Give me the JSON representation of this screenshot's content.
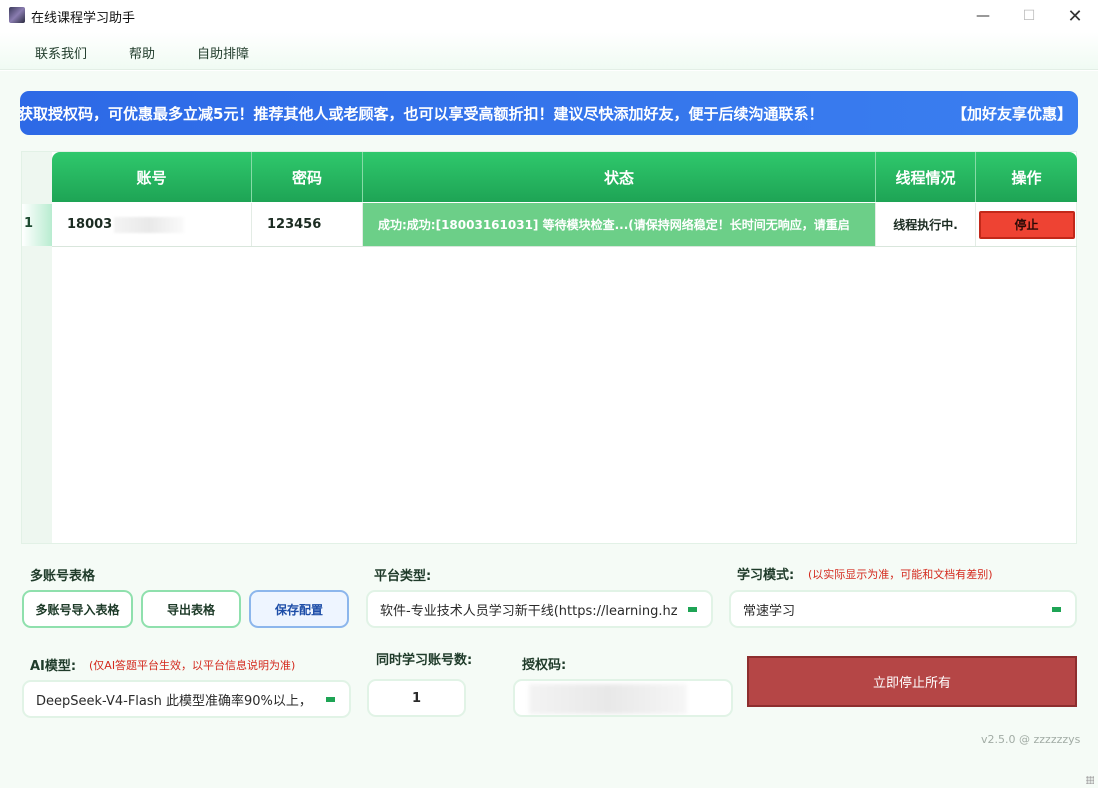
{
  "window": {
    "title": "在线课程学习助手",
    "minimize_glyph": "—",
    "maximize_glyph": "☐",
    "close_glyph": "✕"
  },
  "menu": [
    "联系我们",
    "帮助",
    "自助排障"
  ],
  "banner": {
    "text": "获取授权码，可优惠最多立减5元！推荐其他人或老顾客，也可以享受高额折扣！建议尽快添加好友，便于后续沟通联系！",
    "link": "【加好友享优惠】"
  },
  "table": {
    "headers": [
      "账号",
      "密码",
      "状态",
      "线程情况",
      "操作"
    ],
    "rows": [
      {
        "index": "1",
        "account": "18003",
        "password": "123456",
        "status": "成功:成功:[18003161031] 等待模块检查...(请保持网络稳定！长时间无响应，请重启",
        "thread": "线程执行中.",
        "action": "停止"
      }
    ]
  },
  "multi_account": {
    "label": "多账号表格",
    "import": "多账号导入表格",
    "export": "导出表格",
    "save": "保存配置"
  },
  "platform": {
    "label": "平台类型:",
    "value": "软件-专业技术人员学习新干线(https://learning.hz"
  },
  "study_mode": {
    "label": "学习模式:",
    "note": "(以实际显示为准，可能和文档有差别)",
    "value": "常速学习"
  },
  "ai_model": {
    "label": "AI模型:",
    "note": "(仅AI答题平台生效，以平台信息说明为准)",
    "value": "DeepSeek-V4-Flash  此模型准确率90%以上，"
  },
  "concurrency": {
    "label": "同时学习账号数:",
    "value": "1"
  },
  "auth_code": {
    "label": "授权码:"
  },
  "stop_all": "立即停止所有",
  "version": "v2.5.0 @ zzzzzzys",
  "colors": {
    "accent": "#1ea455",
    "banner": "#2d69e6",
    "stop": "#b54646"
  }
}
